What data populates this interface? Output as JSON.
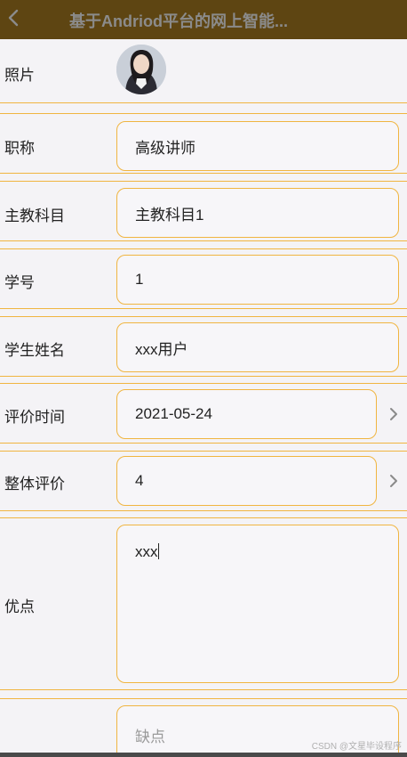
{
  "header": {
    "title": "基于Andriod平台的网上智能..."
  },
  "form": {
    "photo_label": "照片",
    "title_label": "职称",
    "title_value": "高级讲师",
    "subject_label": "主教科目",
    "subject_value": "主教科目1",
    "student_id_label": "学号",
    "student_id_value": "1",
    "student_name_label": "学生姓名",
    "student_name_value": "xxx用户",
    "eval_time_label": "评价时间",
    "eval_time_value": "2021-05-24",
    "overall_label": "整体评价",
    "overall_value": "4",
    "strengths_label": "优点",
    "strengths_value": "xxx",
    "weakness_placeholder": "缺点"
  },
  "watermark": "CSDN @文星毕设程序",
  "colors": {
    "header_bg": "#5e4512",
    "border_accent": "#f0b541",
    "background": "#f4f3f6"
  }
}
